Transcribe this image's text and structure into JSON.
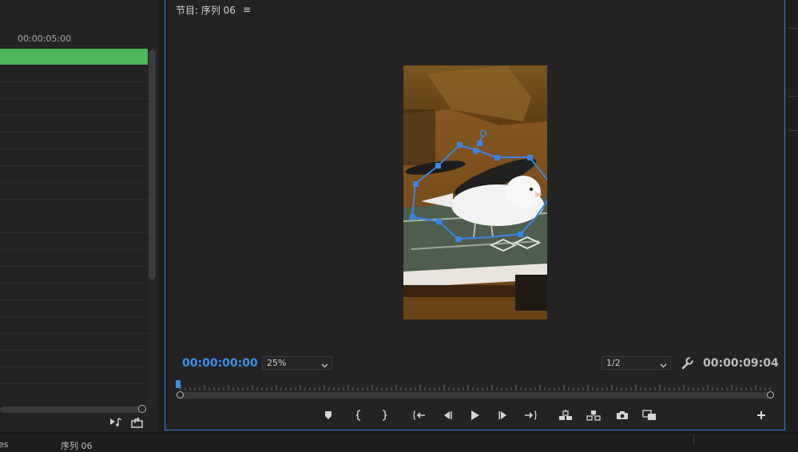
{
  "left_panel": {
    "ruler_time": "00:00:05:00"
  },
  "program_monitor": {
    "title": "节目: 序列 06",
    "menu_glyph": "≡",
    "current_timecode": "00:00:00:00",
    "zoom": "25%",
    "resolution": "1/2",
    "duration_timecode": "00:00:09:04",
    "playhead_position": 0
  },
  "bottom_strip": {
    "tab_a": "es",
    "tab_b": "序列 06"
  },
  "colors": {
    "accent": "#3d8fe8",
    "panel_border": "#2f7ee0",
    "clip_green": "#4db55b",
    "mask_path": "#3a86e6"
  },
  "icons": [
    "marker-icon",
    "mark-in-icon",
    "mark-out-icon",
    "go-to-in-icon",
    "step-back-icon",
    "play-icon",
    "step-forward-icon",
    "go-to-out-icon",
    "lift-icon",
    "extract-icon",
    "camera-icon",
    "compare-icon",
    "add-button-icon",
    "wrench-icon",
    "insert-audio-icon",
    "export-frame-icon"
  ]
}
